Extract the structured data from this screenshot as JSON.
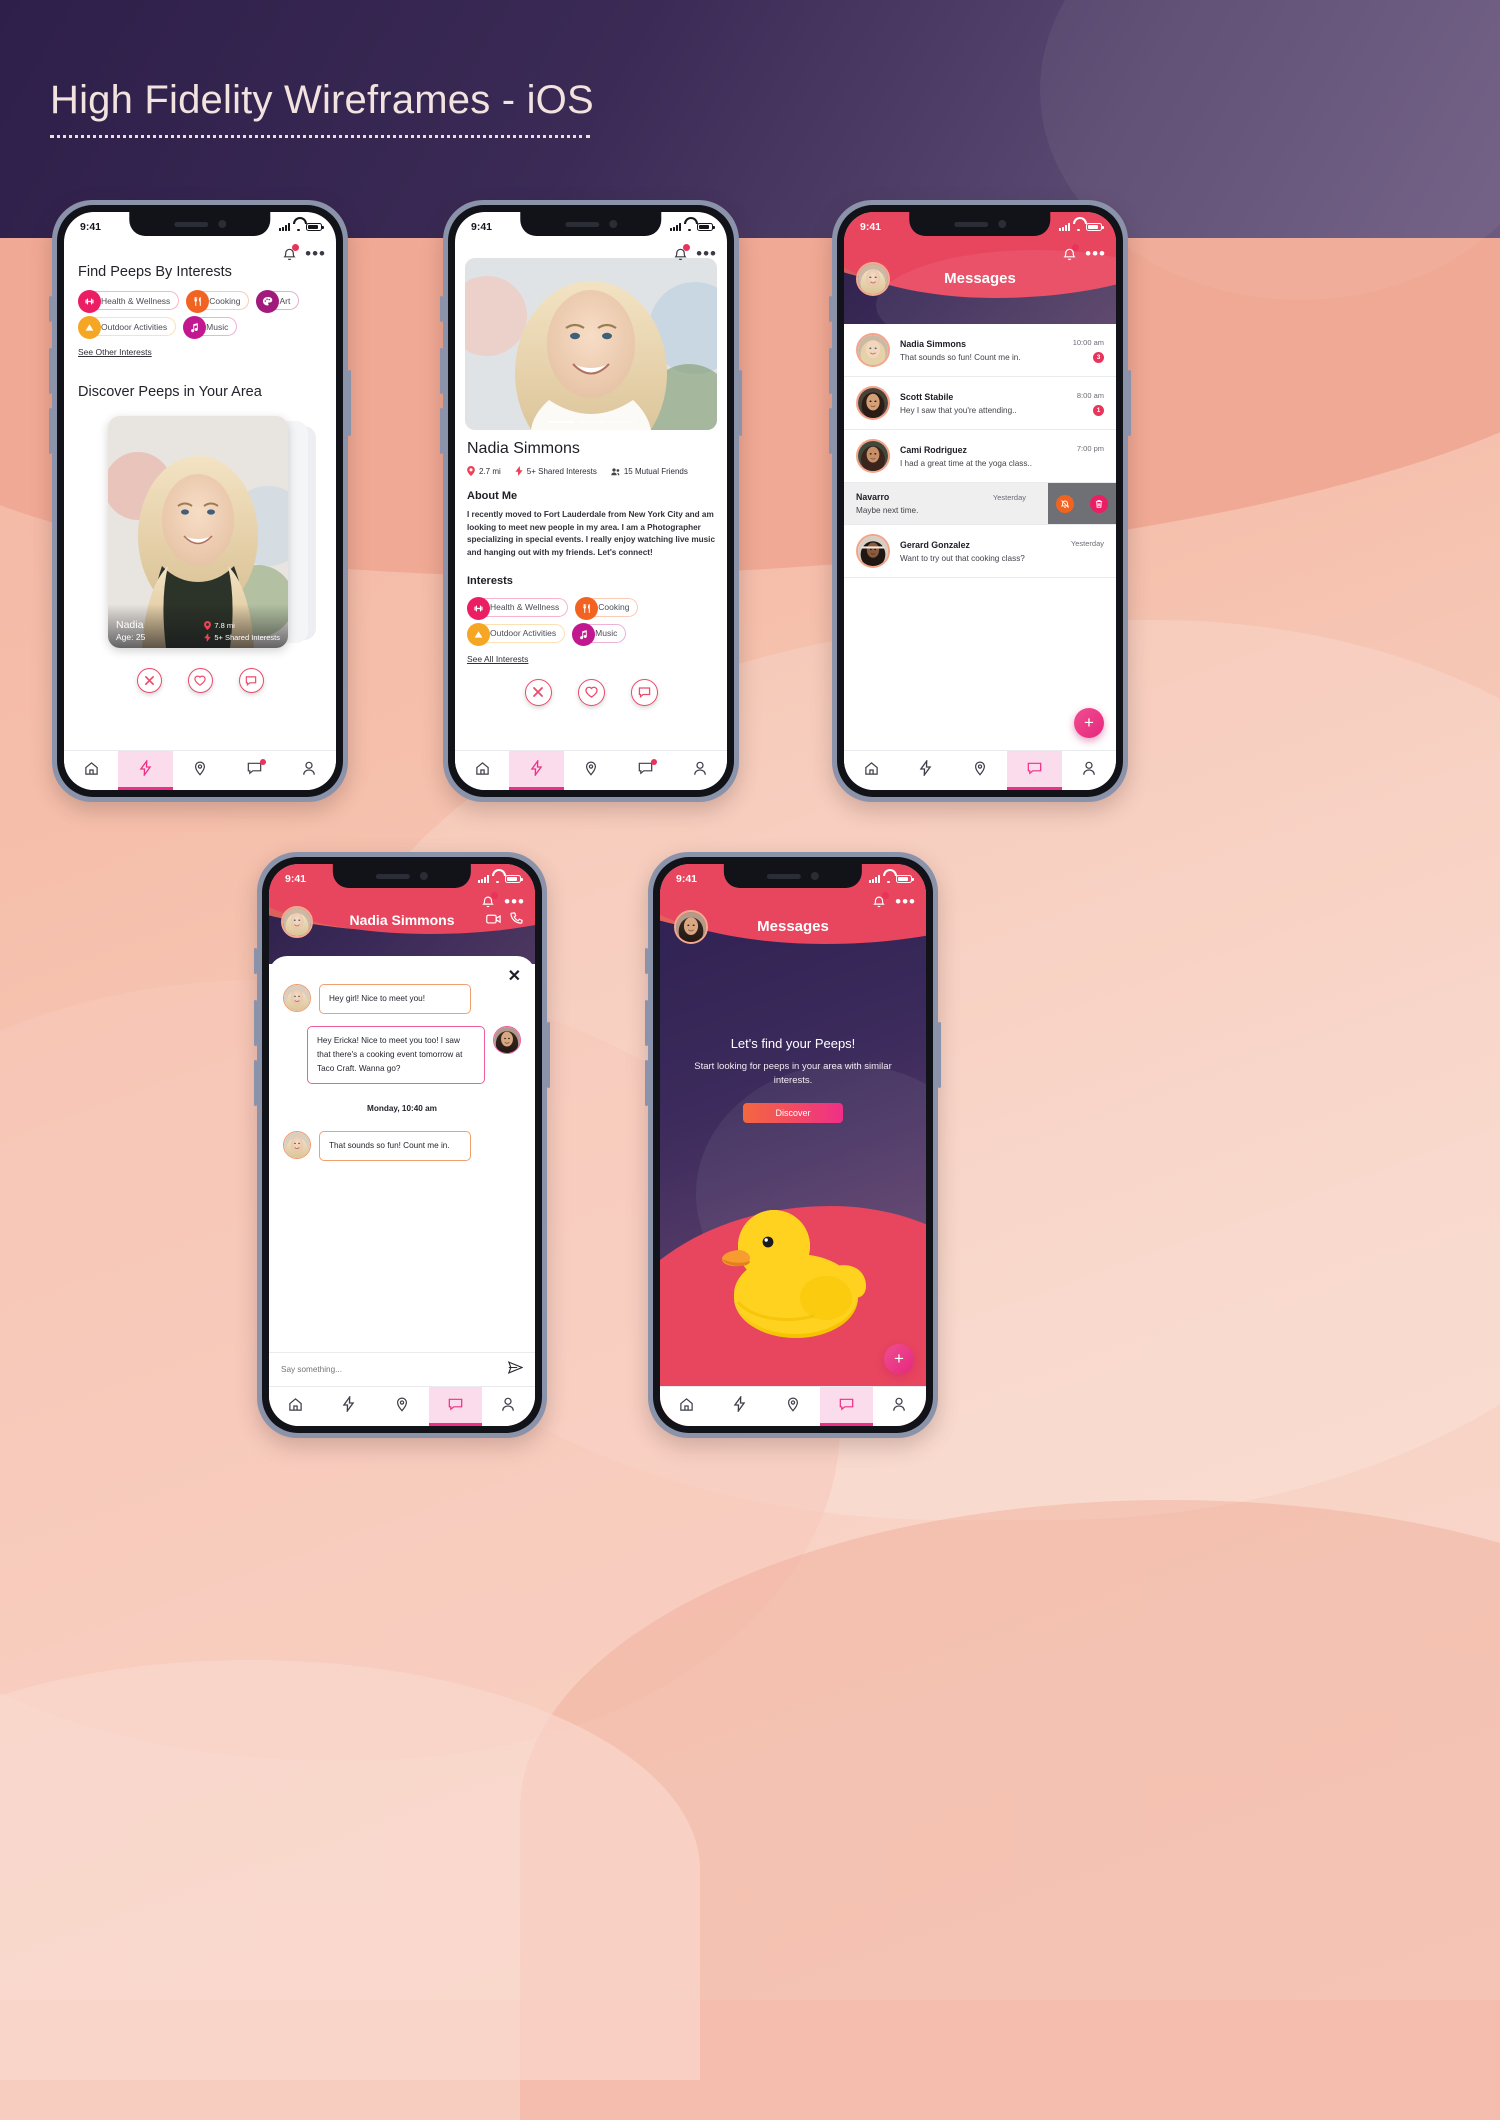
{
  "page": {
    "title": "High Fidelity Wireframes - iOS"
  },
  "common": {
    "status_time": "9:41",
    "icons": {
      "bell": "bell-icon",
      "more": "•••"
    }
  },
  "screen1": {
    "section_title": "Find Peeps By Interests",
    "interests": [
      {
        "label": "Health & Wellness",
        "color": "#ec1e63",
        "icon": "dumbbell-icon",
        "glyph": "⚯"
      },
      {
        "label": "Cooking",
        "color": "#f26322",
        "icon": "utensils-icon",
        "glyph": "ἷ4"
      },
      {
        "label": "Art",
        "color": "#a01b7c",
        "icon": "palette-icon",
        "glyph": "●"
      },
      {
        "label": "Outdoor Activities",
        "color": "#f5a623",
        "icon": "mountain-icon",
        "glyph": "▲"
      },
      {
        "label": "Music",
        "color": "#c2188f",
        "icon": "music-note-icon",
        "glyph": "♫"
      }
    ],
    "see_other_link": "See Other Interests",
    "section_title2": "Discover Peeps in Your Area",
    "card": {
      "name": "Nadia",
      "age": "Age: 25",
      "distance": "7.8 mi",
      "shared": "5+ Shared Interests"
    },
    "actions": [
      "close-button",
      "like-button",
      "message-button"
    ]
  },
  "screen2": {
    "name": "Nadia Simmons",
    "distance": "2.7 mi",
    "shared": "5+ Shared Interests",
    "mutual": "15 Mutual Friends",
    "about_heading": "About Me",
    "about_text": "I recently moved to Fort Lauderdale from New York City and am looking to meet new people in my area. I am a Photographer specializing in special events. I really enjoy watching live music and hanging out with my friends. Let's connect!",
    "interests_heading": "Interests",
    "interests": [
      {
        "label": "Health & Wellness",
        "color": "#ec1e63"
      },
      {
        "label": "Cooking",
        "color": "#f26322"
      },
      {
        "label": "Outdoor Activities",
        "color": "#f5a623"
      },
      {
        "label": "Music",
        "color": "#c2188f"
      }
    ],
    "see_all_link": "See All Interests",
    "carousel_slides": 3,
    "carousel_active": 0
  },
  "screen3": {
    "title": "Messages",
    "rows": [
      {
        "name": "Nadia Simmons",
        "preview": "That sounds so fun! Count me in.",
        "time": "10:00 am",
        "badge": "3",
        "swiped": false
      },
      {
        "name": "Scott Stabile",
        "preview": "Hey I saw that you're attending..",
        "time": "8:00 am",
        "badge": "1",
        "swiped": false
      },
      {
        "name": "Cami Rodriguez",
        "preview": "I had a great time at the yoga class..",
        "time": "7:00 pm",
        "badge": "",
        "swiped": false
      },
      {
        "name": "Navarro",
        "preview": "Maybe next time.",
        "time": "Yesterday",
        "badge": "",
        "swiped": true,
        "swipe_actions": [
          {
            "icon": "mute-bell-icon",
            "color": "#f26322"
          },
          {
            "icon": "trash-icon",
            "color": "#ec1e63"
          }
        ]
      },
      {
        "name": "Gerard Gonzalez",
        "preview": "Want to try out that cooking class?",
        "time": "Yesterday",
        "badge": "",
        "swiped": false
      }
    ],
    "fab_label": "+"
  },
  "screen4": {
    "title": "Nadia Simmons",
    "header_actions": [
      "video-call-icon",
      "phone-call-icon"
    ],
    "close_label": "✕",
    "messages": [
      {
        "side": "left",
        "text": "Hey girl! Nice to meet you!",
        "border": "#f0a06d"
      },
      {
        "side": "right",
        "text": "Hey Ericka! Nice to meet you too! I saw that there's a cooking event tomorrow at Taco Craft. Wanna go?",
        "border": "#ef5fa0"
      }
    ],
    "timestamp": "Monday, 10:40 am",
    "messages2": [
      {
        "side": "left",
        "text": "That sounds so fun! Count me in.",
        "border": "#f0a06d"
      }
    ],
    "input_placeholder": "Say something...",
    "send_icon": "send-icon"
  },
  "screen5": {
    "title": "Messages",
    "heading": "Let's find your Peeps!",
    "subtext": "Start looking for peeps in your area with similar interests.",
    "button_label": "Discover",
    "fab_label": "+",
    "illustration": "rubber-duck-illustration"
  },
  "tabbar": {
    "items": [
      {
        "name": "home",
        "icon": "home-icon"
      },
      {
        "name": "discover",
        "icon": "bolt-icon"
      },
      {
        "name": "places",
        "icon": "map-pin-icon"
      },
      {
        "name": "messages",
        "icon": "chat-icon"
      },
      {
        "name": "profile",
        "icon": "person-icon"
      }
    ],
    "active": {
      "screen1": 1,
      "screen2": 1,
      "screen3": 3,
      "screen4": 3,
      "screen5": 3
    }
  },
  "colors": {
    "accent_pink": "#ef2f87",
    "accent_red": "#e8335b",
    "accent_orange": "#f26322",
    "header_purple": "#2e1f4a",
    "peach_bg": "#f4b8a4"
  }
}
